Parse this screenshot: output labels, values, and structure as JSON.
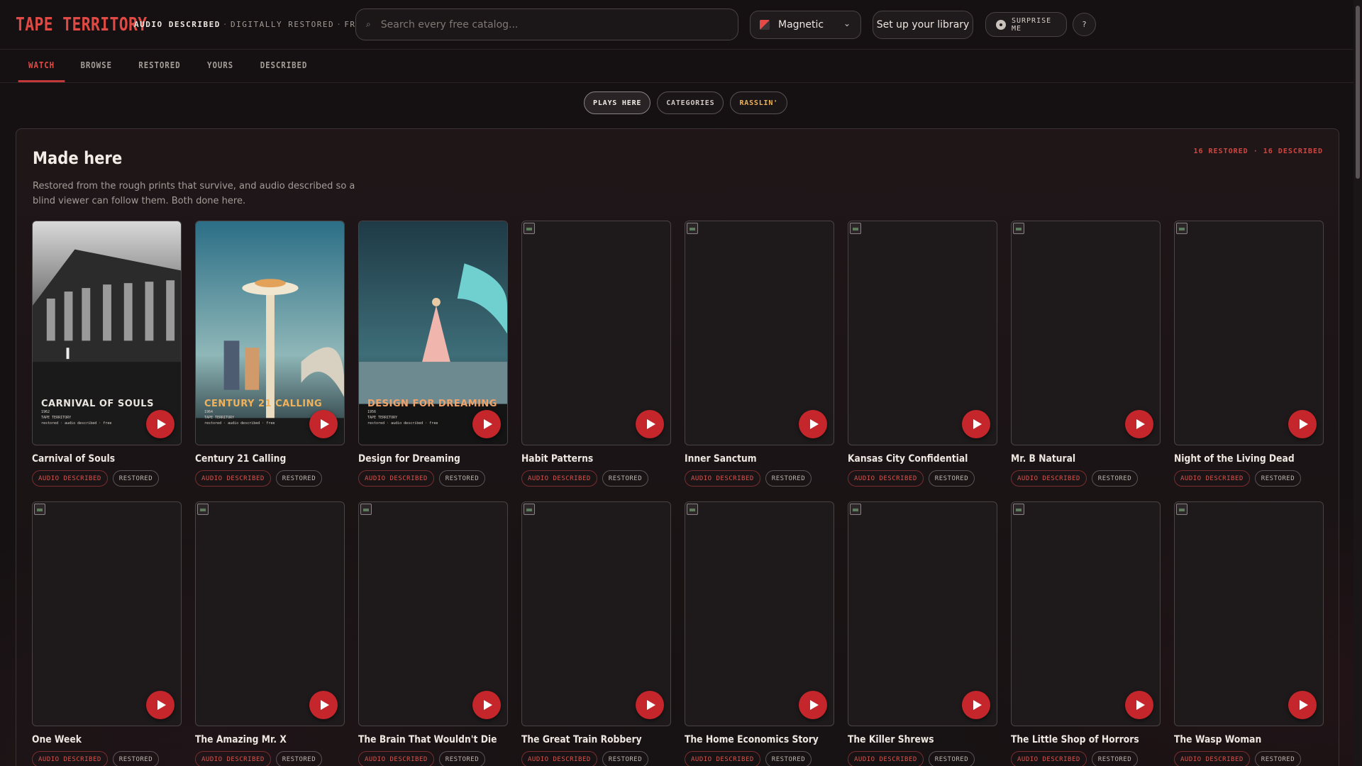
{
  "header": {
    "brand": "TAPE TERRITORY",
    "tagline_strong": "AUDIO DESCRIBED",
    "tagline_rest_1": "DIGITALLY RESTORED",
    "tagline_rest_2": "FREE",
    "search_placeholder": "Search every free catalog...",
    "theme_value": "Magnetic",
    "library_button": "Set up your library",
    "surprise_button": "SURPRISE ME",
    "help_button": "?"
  },
  "tabs": [
    "WATCH",
    "BROWSE",
    "RESTORED",
    "YOURS",
    "DESCRIBED"
  ],
  "pills": [
    "PLAYS HERE",
    "CATEGORIES",
    "RASSLIN'"
  ],
  "section": {
    "title": "Made here",
    "counts": "16 RESTORED · 16 DESCRIBED",
    "description": "Restored from the rough prints that survive, and audio described so a blind viewer can follow them. Both done here."
  },
  "badges": {
    "ad": "AUDIO DESCRIBED",
    "restored": "RESTORED"
  },
  "posters": {
    "carnival": {
      "title": "CARNIVAL OF SOULS",
      "year": "1962",
      "studio": "TAPE TERRITORY",
      "meta": "restored · audio described · free"
    },
    "century": {
      "title": "CENTURY 21 CALLING",
      "year": "1964",
      "studio": "TAPE TERRITORY",
      "meta": "restored · audio described · free"
    },
    "design": {
      "title": "DESIGN FOR DREAMING",
      "year": "1956",
      "studio": "TAPE TERRITORY",
      "meta": "restored · audio described · free"
    }
  },
  "films": [
    {
      "title": "Carnival of Souls",
      "poster": "carnival"
    },
    {
      "title": "Century 21 Calling",
      "poster": "century"
    },
    {
      "title": "Design for Dreaming",
      "poster": "design"
    },
    {
      "title": "Habit Patterns",
      "poster": ""
    },
    {
      "title": "Inner Sanctum",
      "poster": ""
    },
    {
      "title": "Kansas City Confidential",
      "poster": ""
    },
    {
      "title": "Mr. B Natural",
      "poster": ""
    },
    {
      "title": "Night of the Living Dead",
      "poster": ""
    },
    {
      "title": "One Week",
      "poster": ""
    },
    {
      "title": "The Amazing Mr. X",
      "poster": ""
    },
    {
      "title": "The Brain That Wouldn't Die",
      "poster": ""
    },
    {
      "title": "The Great Train Robbery",
      "poster": ""
    },
    {
      "title": "The Home Economics Story",
      "poster": ""
    },
    {
      "title": "The Killer Shrews",
      "poster": ""
    },
    {
      "title": "The Little Shop of Horrors",
      "poster": ""
    },
    {
      "title": "The Wasp Woman",
      "poster": ""
    }
  ],
  "colors": {
    "accent": "#e14a44",
    "play": "#c5262b",
    "background": "#151112",
    "pill_accent": "#f0b25a"
  }
}
